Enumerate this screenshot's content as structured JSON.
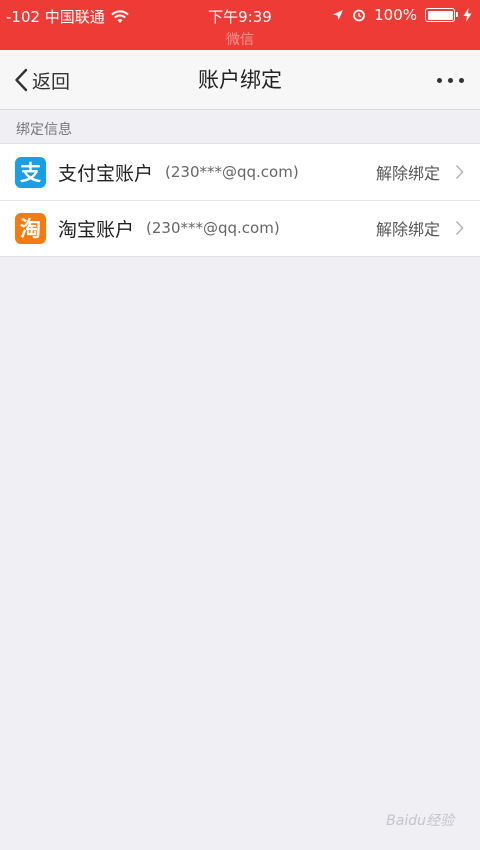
{
  "status_bar": {
    "carrier": "-102 中国联通",
    "time": "下午9:39",
    "battery": "100%",
    "sub_title": "微信",
    "battery_level": 1.0
  },
  "nav": {
    "back_label": "返回",
    "title": "账户绑定"
  },
  "section": {
    "header": "绑定信息"
  },
  "accounts": [
    {
      "icon": "alipay-icon",
      "icon_char": "支",
      "icon_color": "#1a9ee6",
      "name": "支付宝账户",
      "email": "(230***@qq.com)",
      "action": "解除绑定"
    },
    {
      "icon": "taobao-icon",
      "icon_char": "淘",
      "icon_color": "#f47a12",
      "name": "淘宝账户",
      "email": "(230***@qq.com)",
      "action": "解除绑定"
    }
  ],
  "watermark": "Baidu经验"
}
